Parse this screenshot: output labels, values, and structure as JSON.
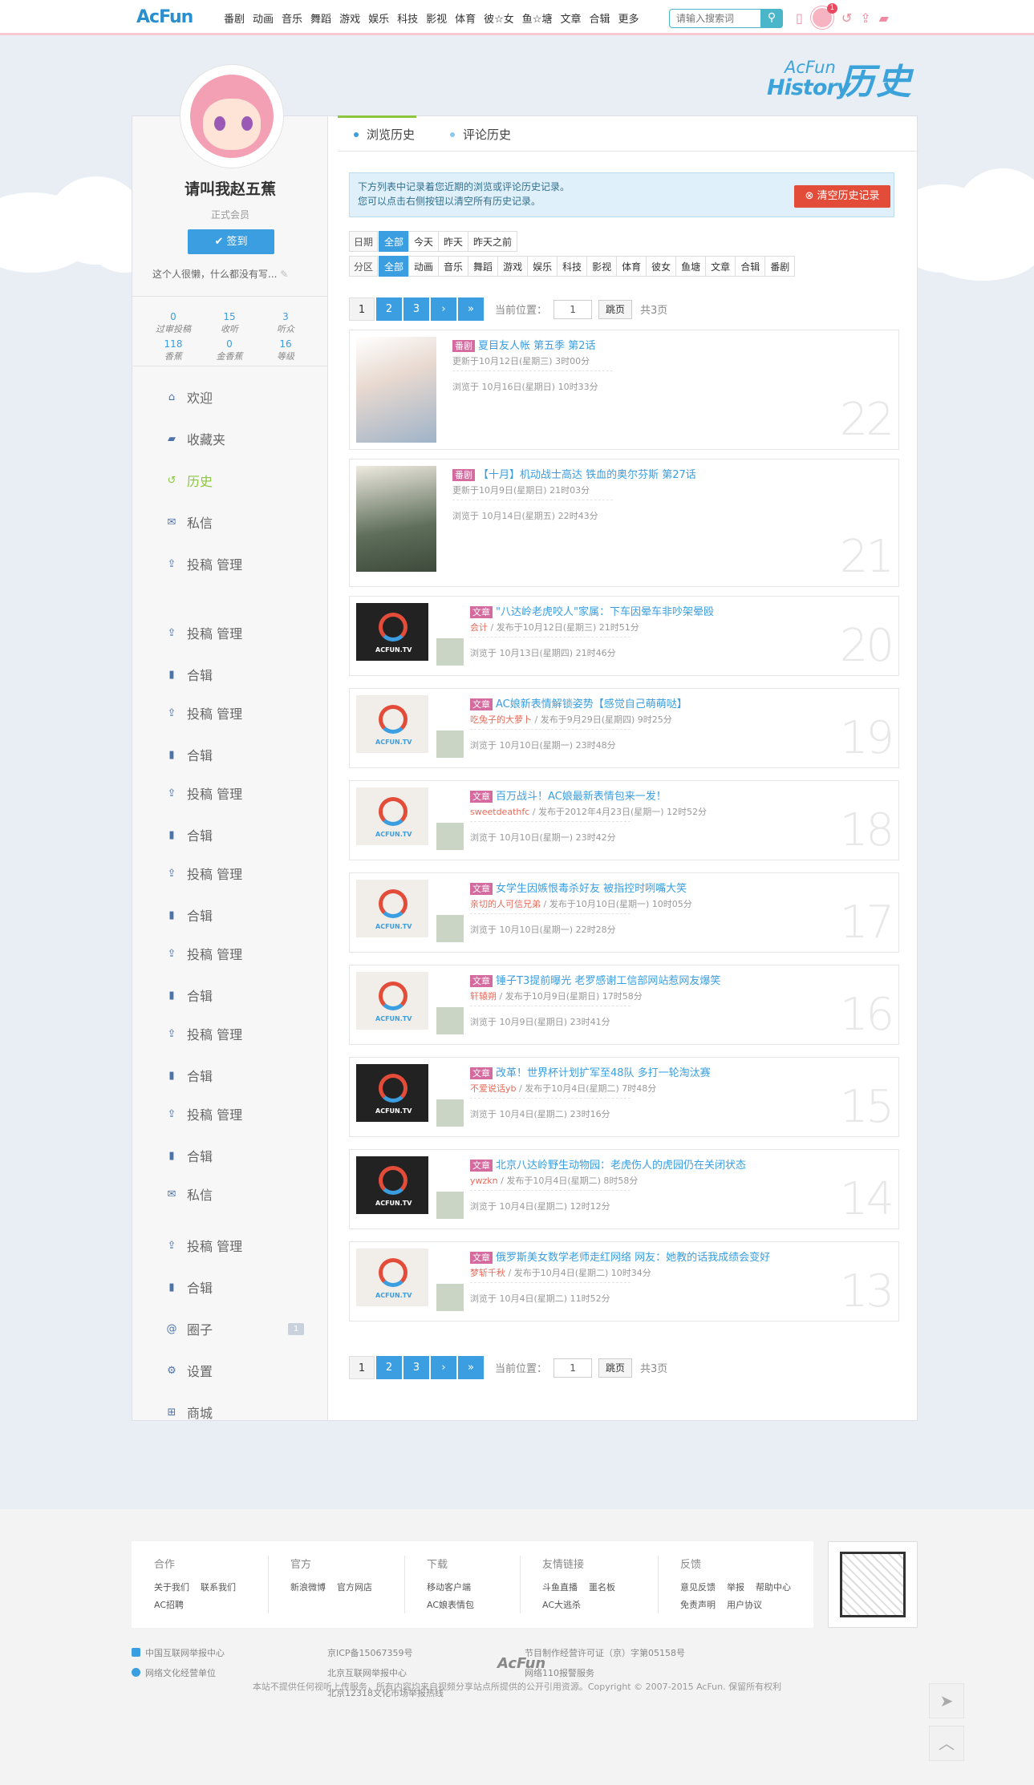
{
  "topbar": {
    "logo": "AcFun",
    "nav": [
      "番剧",
      "动画",
      "音乐",
      "舞蹈",
      "游戏",
      "娱乐",
      "科技",
      "影视",
      "体育",
      "彼☆女",
      "鱼☆塘",
      "文章",
      "合辑",
      "更多"
    ],
    "search_placeholder": "请输入搜索词",
    "notification_count": "1"
  },
  "header": {
    "title_en_top": "AcFun",
    "title_en": "History",
    "title_zh": "历史"
  },
  "profile": {
    "name": "请叫我赵五蕉",
    "role": "正式会员",
    "checkin": "签到",
    "signature": "这个人很懒，什么都没有写...",
    "stats": [
      {
        "n": "0",
        "l": "过审投稿"
      },
      {
        "n": "15",
        "l": "收听"
      },
      {
        "n": "3",
        "l": "听众"
      },
      {
        "n": "118",
        "l": "香蕉"
      },
      {
        "n": "0",
        "l": "金香蕉"
      },
      {
        "n": "16",
        "l": "等级"
      }
    ]
  },
  "menu": [
    {
      "label": "欢迎",
      "icon": "home-icon"
    },
    {
      "label": "收藏夹",
      "icon": "folder-icon"
    },
    {
      "label": "历史",
      "icon": "history-icon"
    },
    {
      "label": "私信",
      "icon": "mail-icon"
    },
    {
      "label": "投稿 管理",
      "icon": "upload-icon"
    },
    {
      "label": "投稿 管理",
      "icon": "upload-icon"
    },
    {
      "label": "合辑",
      "icon": "book-icon"
    },
    {
      "label": "投稿 管理",
      "icon": "upload-icon"
    },
    {
      "label": "合辑",
      "icon": "book-icon"
    },
    {
      "label": "投稿 管理",
      "icon": "upload-icon"
    },
    {
      "label": "合辑",
      "icon": "book-icon"
    },
    {
      "label": "投稿 管理",
      "icon": "upload-icon"
    },
    {
      "label": "合辑",
      "icon": "book-icon"
    },
    {
      "label": "投稿 管理",
      "icon": "upload-icon"
    },
    {
      "label": "合辑",
      "icon": "book-icon"
    },
    {
      "label": "投稿 管理",
      "icon": "upload-icon"
    },
    {
      "label": "合辑",
      "icon": "book-icon"
    },
    {
      "label": "投稿 管理",
      "icon": "upload-icon"
    },
    {
      "label": "合辑",
      "icon": "book-icon"
    },
    {
      "label": "私信",
      "icon": "mail-icon"
    },
    {
      "label": "投稿 管理",
      "icon": "upload-icon"
    },
    {
      "label": "合辑",
      "icon": "book-icon"
    },
    {
      "label": "圈子",
      "icon": "at-icon",
      "count": "1"
    },
    {
      "label": "设置",
      "icon": "gear-icon"
    },
    {
      "label": "商城",
      "icon": "gift-icon"
    }
  ],
  "tabs": [
    "浏览历史",
    "评论历史"
  ],
  "notice": {
    "line1": "下方列表中记录着您近期的浏览或评论历史记录。",
    "line2": "您可以点击右侧按钮以清空所有历史记录。",
    "clear": "清空历史记录"
  },
  "filters": {
    "date_label": "日期",
    "date_options": [
      "全部",
      "今天",
      "昨天",
      "昨天之前"
    ],
    "cat_label": "分区",
    "cat_options": [
      "全部",
      "动画",
      "音乐",
      "舞蹈",
      "游戏",
      "娱乐",
      "科技",
      "影视",
      "体育",
      "彼女",
      "鱼塘",
      "文章",
      "合辑",
      "番剧"
    ]
  },
  "pager": {
    "pages": [
      "1",
      "2",
      "3",
      "›",
      "»"
    ],
    "position_label": "当前位置：",
    "input_value": "1",
    "go": "跳页",
    "total": "共3页"
  },
  "items": [
    {
      "tag": "番剧",
      "title": "夏目友人帐 第五季 第2话",
      "meta": "更新于10月12日(星期三) 3时00分",
      "author": "",
      "viewed": "浏览于 10月16日(星期日) 10时33分",
      "num": "22",
      "thumb": "anime"
    },
    {
      "tag": "番剧",
      "title": "【十月】机动战士高达 铁血的奥尔芬斯 第27话",
      "meta": "更新于10月9日(星期日) 21时03分",
      "author": "",
      "viewed": "浏览于 10月14日(星期五) 22时43分",
      "num": "21",
      "thumb": "gundam"
    },
    {
      "tag": "文章",
      "title": "\"八达岭老虎咬人\"家属：下车因晕车非吵架晕殴",
      "meta": " / 发布于10月12日(星期三) 21时51分",
      "author": "会计",
      "viewed": "浏览于 10月13日(星期四) 21时46分",
      "num": "20",
      "thumb": "tv"
    },
    {
      "tag": "文章",
      "title": "AC娘新表情解锁姿势【感觉自己萌萌哒】",
      "meta": " / 发布于9月29日(星期四) 9时25分",
      "author": "吃兔子的大萝卜",
      "viewed": "浏览于 10月10日(星期一) 23时48分",
      "num": "19",
      "thumb": "tv-light"
    },
    {
      "tag": "文章",
      "title": "百万战斗！AC娘最新表情包来一发！",
      "meta": " / 发布于2012年4月23日(星期一) 12时52分",
      "author": "sweetdeathfc",
      "viewed": "浏览于 10月10日(星期一) 23时42分",
      "num": "18",
      "thumb": "tv-light"
    },
    {
      "tag": "文章",
      "title": "女学生因嫉恨毒杀好友 被指控时咧嘴大笑",
      "meta": " / 发布于10月10日(星期一) 10时05分",
      "author": "亲切的人可信兄弟",
      "viewed": "浏览于 10月10日(星期一) 22时28分",
      "num": "17",
      "thumb": "tv-light"
    },
    {
      "tag": "文章",
      "title": "锤子T3提前曝光 老罗感谢工信部网站惹网友爆笑",
      "meta": " / 发布于10月9日(星期日) 17时58分",
      "author": "轩辕朔",
      "viewed": "浏览于 10月9日(星期日) 23时41分",
      "num": "16",
      "thumb": "tv-light"
    },
    {
      "tag": "文章",
      "title": "改革！世界杯计划扩军至48队 多打一轮淘汰赛",
      "meta": " / 发布于10月4日(星期二) 7时48分",
      "author": "不爱说话yb",
      "viewed": "浏览于 10月4日(星期二) 23时16分",
      "num": "15",
      "thumb": "tv"
    },
    {
      "tag": "文章",
      "title": "北京八达岭野生动物园：老虎伤人的虎园仍在关闭状态",
      "meta": " / 发布于10月4日(星期二) 8时58分",
      "author": "ywzkn",
      "viewed": "浏览于 10月4日(星期二) 12时12分",
      "num": "14",
      "thumb": "tv"
    },
    {
      "tag": "文章",
      "title": "俄罗斯美女数学老师走红网络 网友：她教的话我成绩会变好",
      "meta": " / 发布于10月4日(星期二) 10时34分",
      "author": "梦斩千秋",
      "viewed": "浏览于 10月4日(星期二) 11时52分",
      "num": "13",
      "thumb": "tv-light"
    }
  ],
  "footer": {
    "cols": [
      {
        "h": "合作",
        "r1": [
          "关于我们",
          "联系我们"
        ],
        "r2": [
          "AC招聘"
        ]
      },
      {
        "h": "官方",
        "r1": [
          "新浪微博",
          "官方网店"
        ],
        "r2": []
      },
      {
        "h": "下载",
        "r1": [
          "移动客户端"
        ],
        "r2": [
          "AC娘表情包"
        ]
      },
      {
        "h": "友情链接",
        "r1": [
          "斗鱼直播",
          "噩名板"
        ],
        "r2": [
          "AC大逃杀"
        ]
      },
      {
        "h": "反馈",
        "r1": [
          "意见反馈",
          "举报",
          "帮助中心"
        ],
        "r2": [
          "免责声明",
          "用户协议"
        ]
      }
    ],
    "links": {
      "a1": "中国互联网举报中心",
      "a2": "网络文化经营单位",
      "b1": "京ICP备15067359号",
      "b2": "北京互联网举报中心",
      "b3": "北京12318文化市场举报热线",
      "c1": "节目制作经营许可证（京）字第05158号",
      "c2": "网络110报警服务"
    },
    "logo": "AcFun",
    "copyright": "本站不提供任何视听上传服务，所有内容均来自视频分享站点所提供的公开引用资源。Copyright © 2007-2015 AcFun. 保留所有权利"
  }
}
